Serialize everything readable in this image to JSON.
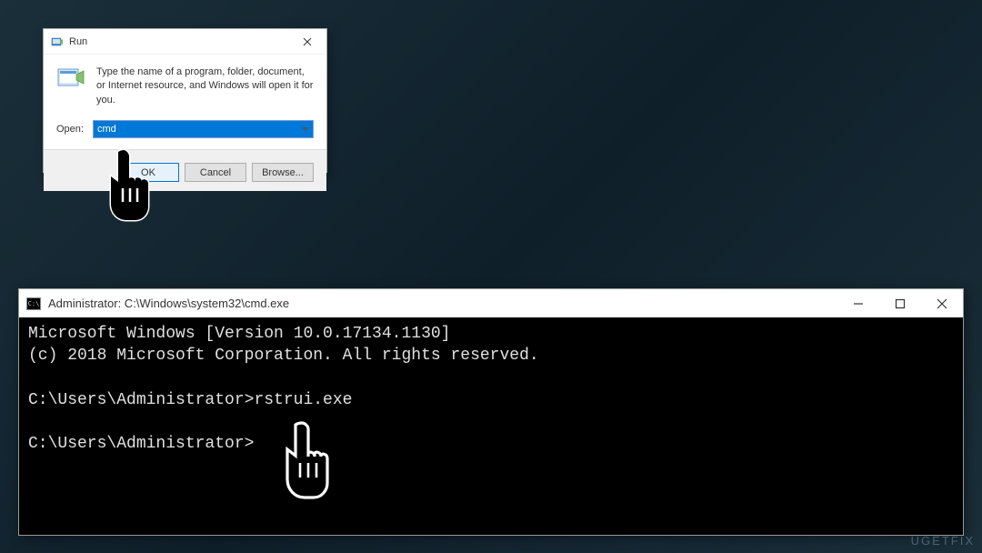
{
  "run_dialog": {
    "title": "Run",
    "description": "Type the name of a program, folder, document, or Internet resource, and Windows will open it for you.",
    "open_label": "Open:",
    "input_value": "cmd",
    "buttons": {
      "ok": "OK",
      "cancel": "Cancel",
      "browse": "Browse..."
    }
  },
  "cmd_window": {
    "title": "Administrator: C:\\Windows\\system32\\cmd.exe",
    "lines": {
      "l1": "Microsoft Windows [Version 10.0.17134.1130]",
      "l2": "(c) 2018 Microsoft Corporation. All rights reserved.",
      "l3": "",
      "l4": "C:\\Users\\Administrator>rstrui.exe",
      "l5": "",
      "l6": "C:\\Users\\Administrator>"
    }
  },
  "watermark": "UGETFIX"
}
